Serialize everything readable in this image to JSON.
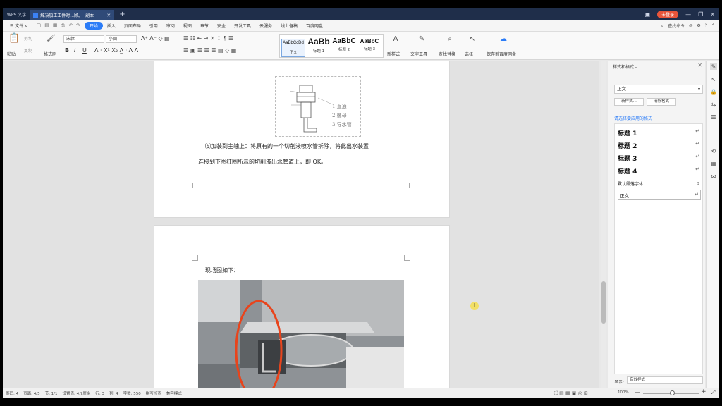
{
  "titlebar": {
    "app_tab": "WPS 文字",
    "doc_tab": "解决加工工件时...顾。- 副本",
    "new_tab": "+",
    "login": "未登录",
    "controls": [
      "—",
      "❐",
      "✕"
    ]
  },
  "menubar": {
    "file": "☰ 文件 ∨",
    "tabs": [
      "开始",
      "插入",
      "页面布局",
      "引用",
      "审阅",
      "视图",
      "章节",
      "安全",
      "开发工具",
      "云服务",
      "线上备稿",
      "百度网盘"
    ],
    "active_tab": "开始",
    "search": "查找命令"
  },
  "ribbon": {
    "paste": "粘贴",
    "cut": "剪切",
    "copy": "复制",
    "format_painter": "格式刷",
    "font_name": "宋体",
    "font_size": "小四",
    "styles": [
      {
        "sample": "AaBbCcDd",
        "label": "正文"
      },
      {
        "sample": "AaBb",
        "label": "标题 1"
      },
      {
        "sample": "AaBbC",
        "label": "标题 2"
      },
      {
        "sample": "AaBbC",
        "label": "标题 3"
      }
    ],
    "new_style": "新样式",
    "text_tools": "文字工具",
    "find_replace": "查找替换",
    "select": "选择",
    "save_baidu": "保存到百度网盘"
  },
  "document": {
    "diagram_labels": [
      "1 直通",
      "2 螺母",
      "3 导水管"
    ],
    "para1_line1": "⑸加装到主轴上：将原有的一个切削液喷水管拆除，将此出水装置",
    "para1_line2": "连接到下图红圈所示的切削液出水管道上，即 OK。",
    "para2": "现场图如下："
  },
  "style_panel": {
    "title": "样式和格式 -",
    "current": "正文",
    "new_style_btn": "新样式...",
    "clear_btn": "清除格式",
    "pick_label": "请选择要应用的格式",
    "items": [
      "标题 1",
      "标题 2",
      "标题 3",
      "标题 4"
    ],
    "default_font": "默认段落字体",
    "body": "正文",
    "show_label": "显示:",
    "show_value": "有效样式"
  },
  "statusbar": {
    "items": [
      "页码: 4",
      "页面: 4/5",
      "节: 1/1",
      "设置值: 4.7厘米",
      "行: 3",
      "列: 4",
      "字数: 550",
      "拼写检查",
      "兼容模式"
    ],
    "zoom": "100%"
  },
  "colors": {
    "accent": "#2b7cf7",
    "titlebar": "#1f2e4a",
    "annotation_red": "#e8441c"
  }
}
